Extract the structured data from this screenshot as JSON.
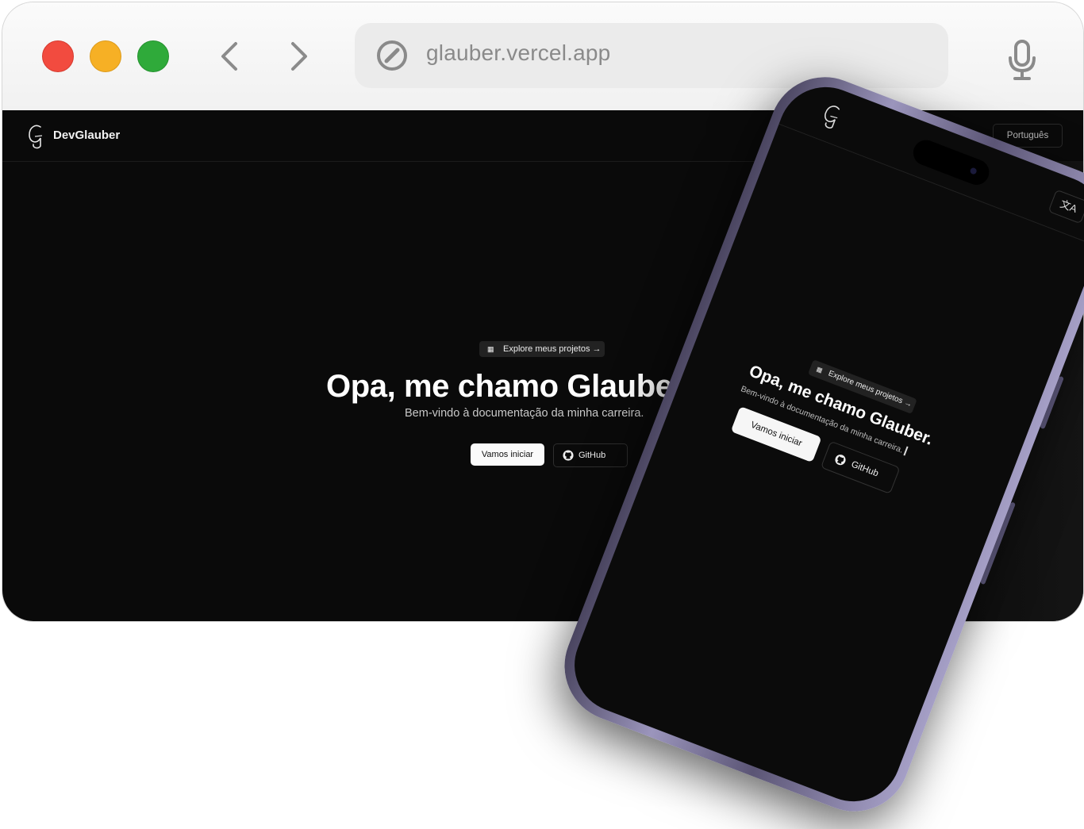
{
  "browser": {
    "url": "glauber.vercel.app",
    "icons": [
      "close-dot",
      "minimize-dot",
      "maximize-dot",
      "back-arrow-icon",
      "forward-arrow-icon",
      "compass-icon",
      "microphone-icon"
    ],
    "colors": {
      "close": "#f24b3f",
      "minimize": "#f6b025",
      "maximize": "#2faa3a"
    }
  },
  "site": {
    "brand": "DevGlauber",
    "logo": "G",
    "language_button": "Português",
    "hero": {
      "pill_label": "Explore meus projetos →",
      "title": "Opa, me chamo Glauber.",
      "subtitle": "Bem-vindo à documentação da minha carreira.",
      "start_button": "Vamos iniciar",
      "github_button": "GitHub"
    }
  },
  "mobile": {
    "logo": "G",
    "translate_icon": "文A",
    "pill_label": "Explore meus projetos →",
    "title": "Opa, me chamo Glauber.",
    "subtitle": "Bem-vindo à documentação da minha carreira.",
    "start_button": "Vamos iniciar",
    "github_button": "GitHub"
  }
}
